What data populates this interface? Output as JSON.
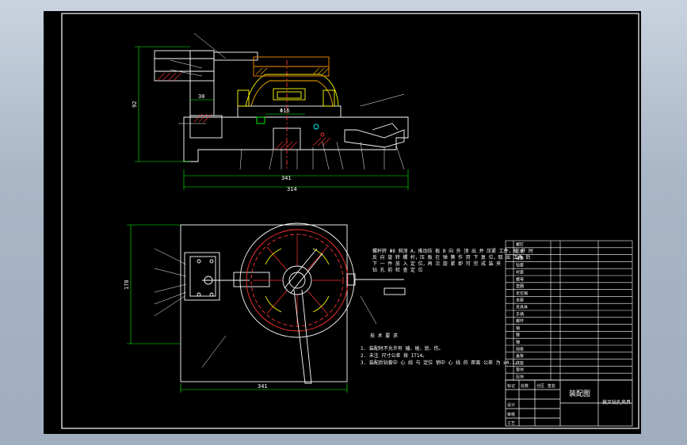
{
  "drawing": {
    "title_text": "装配图",
    "part_name": "拨叉钻孔夹具",
    "dims": {
      "front_height": "92",
      "front_width_a": "341",
      "front_width_b": "314",
      "front_gap": "30",
      "front_bore": "Φ16",
      "top_height": "178",
      "top_width": "341"
    },
    "notes_title": "技 术 要 求",
    "notes": [
      "1. 装配时不允许有 磕、碰、划、伤。",
      "2. 未注 尺寸公差 按 IT14。",
      "3. 装配后钻套中 心 线 与 定位 销中 心 线 的 距离 公差 为 ±0.1。"
    ],
    "side_text": [
      "螺杆转 Φ8 斜顶 A，推动压 板 B 向 外 顶 出 并 压紧 工件，松 开 时",
      "反 向 旋 转 螺 杆，压 板 在 弹 簧 作 用 下 复 位，取 出 工件 后",
      "下 一 件 放 入 定 位，再 次 旋 紧 即 可 完 成 装 夹",
      "钻 孔 前 检 查 定 位"
    ],
    "bom_labels": [
      "螺钉",
      "压板",
      "弹簧",
      "钻套",
      "衬套",
      "螺母",
      "垫圈",
      "定位销",
      "支座",
      "夹具体",
      "手柄",
      "螺杆",
      "销",
      "键",
      "轴",
      "挡板",
      "盖板",
      "底座",
      "垫块",
      "压块"
    ],
    "title_block": {
      "c1": "标记",
      "c2": "处数",
      "c3": "分区",
      "c4": "签名",
      "d1": "设计",
      "d2": "审核",
      "d3": "工艺"
    }
  }
}
